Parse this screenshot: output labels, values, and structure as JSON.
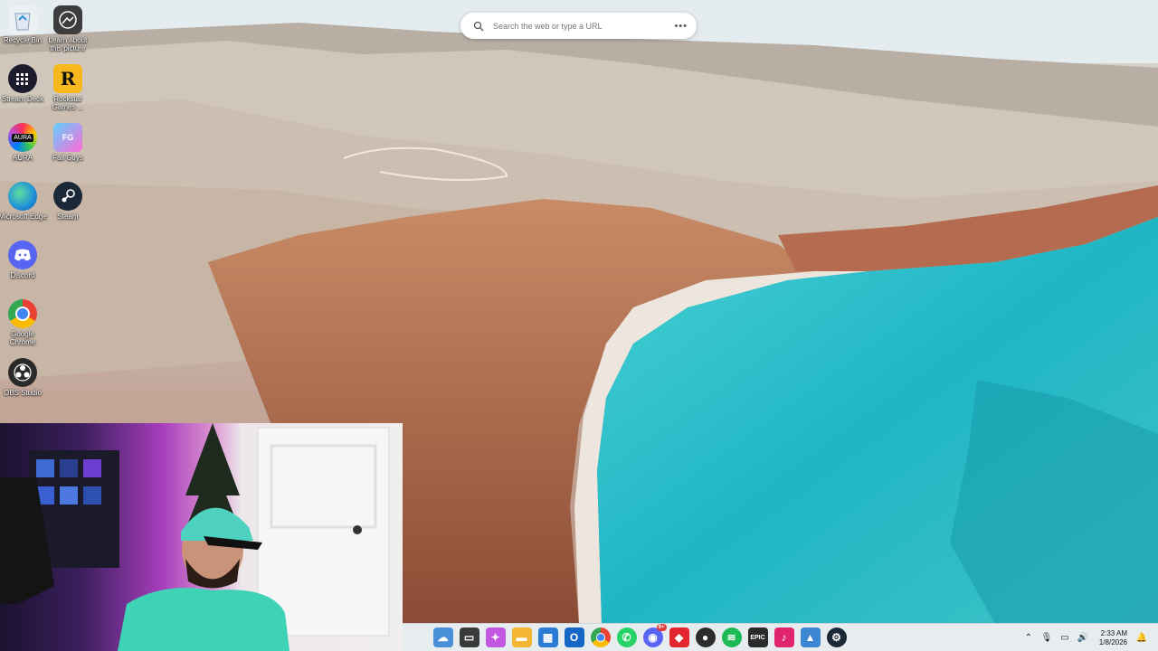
{
  "search": {
    "placeholder": "Search the web or type a URL",
    "more_icon": "more-horizontal-icon",
    "search_icon": "magnifier-icon"
  },
  "desktop_icons": [
    {
      "label": "Recycle Bin",
      "icon": "recycle-bin-icon"
    },
    {
      "label": "Learn about this picture",
      "icon": "spotlight-icon"
    },
    {
      "label": "Stream Deck",
      "icon": "stream-deck-icon"
    },
    {
      "label": "Rockstar Games ...",
      "icon": "rockstar-icon"
    },
    {
      "label": "AURA",
      "icon": "aura-sync-icon"
    },
    {
      "label": "Fall Guys",
      "icon": "fall-guys-icon"
    },
    {
      "label": "Microsoft Edge",
      "icon": "edge-icon"
    },
    {
      "label": "Steam",
      "icon": "steam-icon"
    },
    {
      "label": "Discord",
      "icon": "discord-icon"
    },
    {
      "label": "Google Chrome",
      "icon": "chrome-icon"
    },
    {
      "label": "OBS Studio",
      "icon": "obs-icon"
    }
  ],
  "taskbar": {
    "apps": [
      {
        "name": "weather-icon",
        "color": "#4a90d9"
      },
      {
        "name": "task-view-icon",
        "color": "#3a3a3a"
      },
      {
        "name": "copilot-icon",
        "color": "#c257e0"
      },
      {
        "name": "file-explorer-icon",
        "color": "#f2b632"
      },
      {
        "name": "microsoft-store-icon",
        "color": "#2b7bd6"
      },
      {
        "name": "outlook-icon",
        "color": "#1666c5"
      },
      {
        "name": "chrome-icon",
        "color": "#e0452f"
      },
      {
        "name": "whatsapp-icon",
        "color": "#25d366"
      },
      {
        "name": "discord-icon",
        "color": "#5865f2"
      },
      {
        "name": "red-app-icon",
        "color": "#e3262f"
      },
      {
        "name": "obs-icon",
        "color": "#2c2c2c"
      },
      {
        "name": "spotify-icon",
        "color": "#1db954"
      },
      {
        "name": "epic-games-icon",
        "color": "#2a2a2a"
      },
      {
        "name": "tiktok-icon",
        "color": "#e0246d"
      },
      {
        "name": "photos-icon",
        "color": "#3d86d1"
      },
      {
        "name": "steam-icon",
        "color": "#1b2838"
      }
    ],
    "badges": {
      "discord": "9+"
    },
    "tray": [
      "chevron-up-icon",
      "microphone-icon",
      "network-icon",
      "volume-icon"
    ],
    "time": "2:33 AM",
    "date": "1/8/2026",
    "notification_icon": "notification-bell-icon"
  }
}
